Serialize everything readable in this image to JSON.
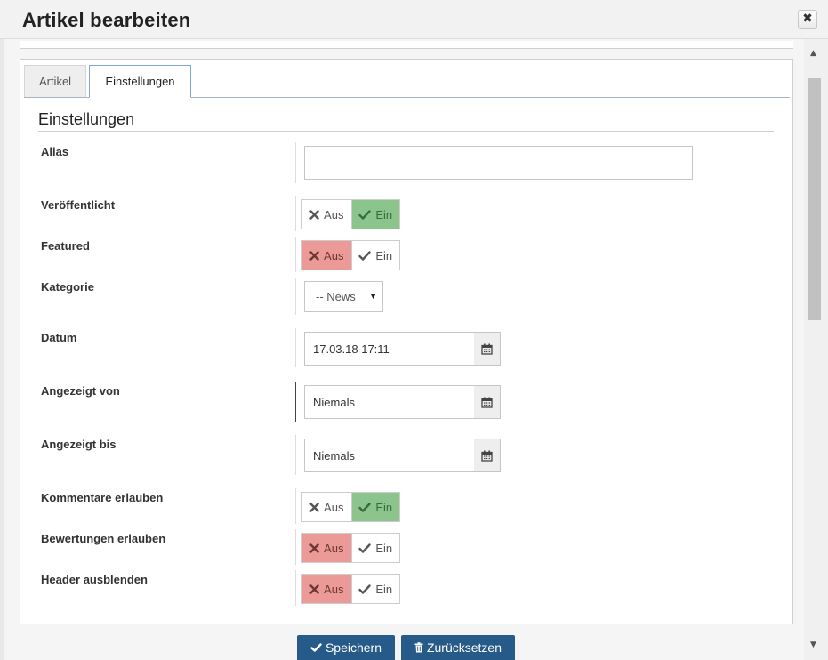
{
  "dialog": {
    "title": "Artikel bearbeiten",
    "close_icon": "close-icon"
  },
  "tabs": [
    {
      "label": "Artikel",
      "active": false
    },
    {
      "label": "Einstellungen",
      "active": true
    }
  ],
  "section": {
    "title": "Einstellungen"
  },
  "fields": {
    "alias": {
      "label": "Alias",
      "value": ""
    },
    "published": {
      "label": "Veröffentlicht",
      "off": "Aus",
      "on": "Ein",
      "state": "Ein"
    },
    "featured": {
      "label": "Featured",
      "off": "Aus",
      "on": "Ein",
      "state": "Aus"
    },
    "category": {
      "label": "Kategorie",
      "value": "-- News"
    },
    "date": {
      "label": "Datum",
      "value": "17.03.18 17:11"
    },
    "shown_from": {
      "label": "Angezeigt von",
      "value": "Niemals"
    },
    "shown_until": {
      "label": "Angezeigt bis",
      "value": "Niemals"
    },
    "comments": {
      "label": "Kommentare erlauben",
      "off": "Aus",
      "on": "Ein",
      "state": "Ein"
    },
    "ratings": {
      "label": "Bewertungen erlauben",
      "off": "Aus",
      "on": "Ein",
      "state": "Aus"
    },
    "hide_header": {
      "label": "Header ausblenden",
      "off": "Aus",
      "on": "Ein",
      "state": "Aus"
    }
  },
  "buttons": {
    "save": "Speichern",
    "reset": "Zurücksetzen"
  },
  "colors": {
    "on_green": "#8cc58c",
    "off_red": "#ec9a98",
    "primary_button": "#265a88",
    "active_tab_border": "#7ea6d8"
  }
}
